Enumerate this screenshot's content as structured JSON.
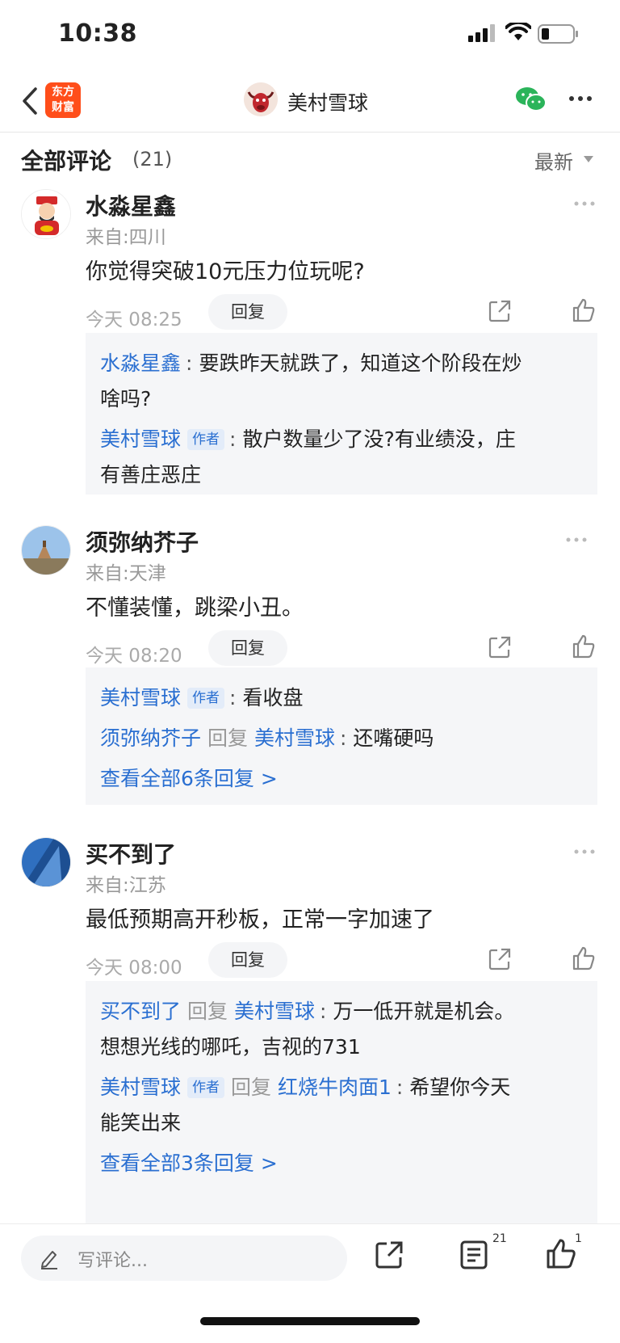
{
  "status_bar": {
    "time": "10:38"
  },
  "nav": {
    "logo_line1": "东方",
    "logo_line2": "财富",
    "title": "美村雪球",
    "brand_color": "#ff4e1a"
  },
  "section": {
    "title": "全部评论",
    "count": "(21)",
    "sort_label": "最新"
  },
  "comments": [
    {
      "name": "水淼星鑫",
      "location": "来自:四川",
      "text": "你觉得突破10元压力位玩呢?",
      "time": "今天 08:25",
      "reply_label": "回复",
      "replies": [
        {
          "user": "水淼星鑫",
          "text": "要跌昨天就跌了，知道这个阶段在炒",
          "text2": "啥吗?"
        },
        {
          "user": "美村雪球",
          "tag": "作者",
          "text": "散户数量少了没?有业绩没，庄",
          "text2": "有善庄恶庄"
        }
      ]
    },
    {
      "name": "须弥纳芥子",
      "location": "来自:天津",
      "text": "不懂装懂，跳梁小丑。",
      "time": "今天 08:20",
      "reply_label": "回复",
      "replies": [
        {
          "user": "美村雪球",
          "tag": "作者",
          "text": "看收盘"
        },
        {
          "user": "须弥纳芥子",
          "reply_word": "回复",
          "target": "美村雪球",
          "text": "还嘴硬吗"
        }
      ],
      "see_all": "查看全部6条回复 >"
    },
    {
      "name": "买不到了",
      "location": "来自:江苏",
      "text": "最低预期高开秒板，正常一字加速了",
      "time": "今天 08:00",
      "reply_label": "回复",
      "replies": [
        {
          "user": "买不到了",
          "reply_word": "回复",
          "target": "美村雪球",
          "text": "万一低开就是机会。",
          "text2": "想想光线的哪吒，吉视的731"
        },
        {
          "user": "美村雪球",
          "tag": "作者",
          "reply_word": "回复",
          "target": "红烧牛肉面1",
          "text": "希望你今天",
          "text2": "能笑出来"
        }
      ],
      "see_all": "查看全部3条回复 >"
    }
  ],
  "bottom_bar": {
    "write_placeholder": "写评论...",
    "comment_count": "21",
    "like_count": "1"
  },
  "colors": {
    "link": "#2a6fd1",
    "muted": "#999999",
    "reply_bg": "#f5f6f8"
  },
  "icons": [
    "back-icon",
    "wechat-icon",
    "more-icon",
    "share-icon",
    "like-icon",
    "pen-icon",
    "list-icon"
  ]
}
